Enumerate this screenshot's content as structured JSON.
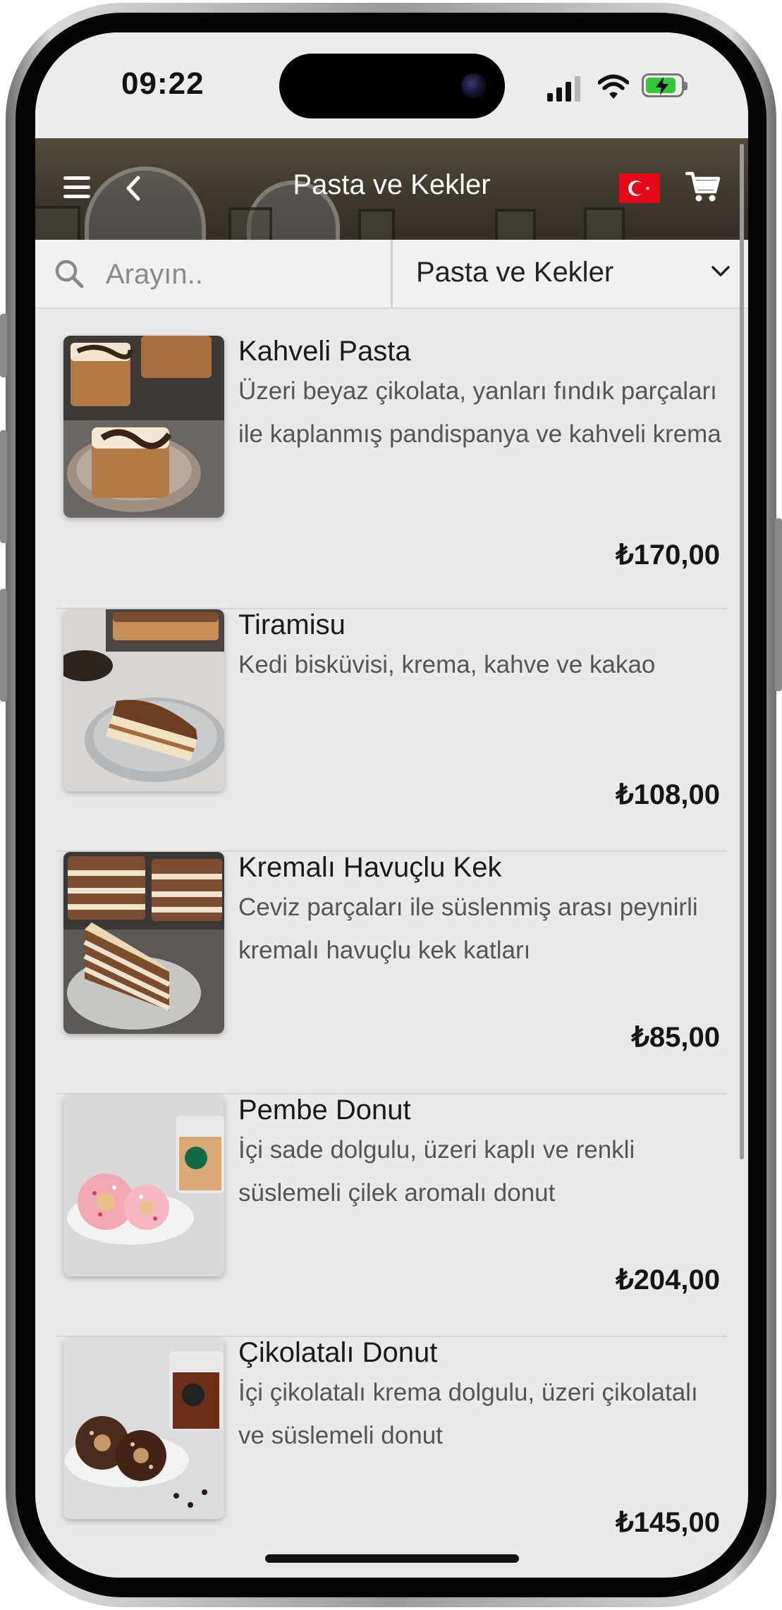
{
  "status_bar": {
    "time": "09:22"
  },
  "header": {
    "title": "Pasta ve Kekler",
    "flag_icon": "turkish-flag-icon",
    "cart_icon": "cart-icon"
  },
  "search": {
    "placeholder": "Arayın..",
    "value": ""
  },
  "category": {
    "selected": "Pasta ve Kekler"
  },
  "products": [
    {
      "name": "Kahveli Pasta",
      "description": "Üzeri beyaz çikolata, yanları fındık parçaları ile kaplanmış pandispanya ve kahveli krema",
      "price": "₺170,00"
    },
    {
      "name": "Tiramisu",
      "description": "Kedi bisküvisi, krema, kahve ve kakao",
      "price": "₺108,00"
    },
    {
      "name": "Kremalı Havuçlu Kek",
      "description": "Ceviz parçaları ile süslenmiş arası peynirli kremalı havuçlu kek katları",
      "price": "₺85,00"
    },
    {
      "name": "Pembe Donut",
      "description": "İçi sade dolgulu, üzeri kaplı ve renkli süslemeli çilek aromalı donut",
      "price": "₺204,00"
    },
    {
      "name": "Çikolatalı Donut",
      "description": "İçi çikolatalı krema dolgulu, üzeri çikolatalı ve süslemeli donut",
      "price": "₺145,00"
    }
  ],
  "colors": {
    "header_bg": "#4b4539",
    "flag_red": "#e30a17",
    "list_bg": "#e9e9e9",
    "battery_green": "#35c63e"
  }
}
